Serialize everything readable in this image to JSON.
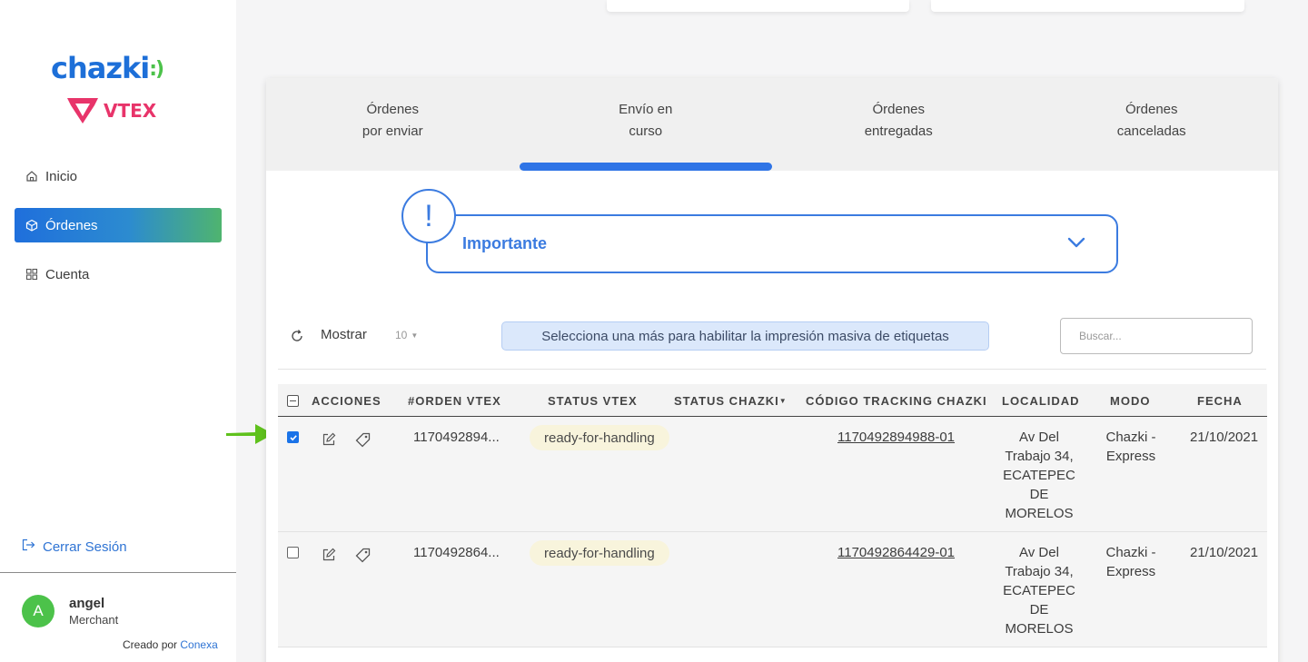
{
  "brand": {
    "chazki_text": "chazki",
    "chazki_signal": ":)",
    "vtex_text": "VTEX",
    "colors": {
      "primary": "#2f74e6",
      "green": "#4cc24a",
      "vtex": "#e8346a"
    }
  },
  "sidebar": {
    "items": [
      {
        "label": "Inicio",
        "icon": "home-icon",
        "active": false
      },
      {
        "label": "Órdenes",
        "icon": "box-icon",
        "active": true
      },
      {
        "label": "Cuenta",
        "icon": "grid-icon",
        "active": false
      }
    ],
    "logout_label": "Cerrar Sesión",
    "user": {
      "initial": "A",
      "name": "angel",
      "role": "Merchant"
    },
    "credit_prefix": "Creado por",
    "credit_link": "Conexa"
  },
  "tabs": [
    {
      "line1": "Órdenes",
      "line2": "por enviar",
      "active": false
    },
    {
      "line1": "Envío en",
      "line2": "curso",
      "active": true
    },
    {
      "line1": "Órdenes",
      "line2": "entregadas",
      "active": false
    },
    {
      "line1": "Órdenes",
      "line2": "canceladas",
      "active": false
    }
  ],
  "alert": {
    "icon_text": "!",
    "title": "Importante"
  },
  "toolbar": {
    "show_label": "Mostrar",
    "page_size": "10",
    "bulk_notice": "Selecciona una más para habilitar la impresión masiva de etiquetas",
    "search_placeholder": "Buscar..."
  },
  "table": {
    "headers": {
      "acciones": "ACCIONES",
      "orden": "#ORDEN VTEX",
      "status_vtex": "STATUS VTEX",
      "status_chazki": "STATUS CHAZKI",
      "tracking": "CÓDIGO TRACKING CHAZKI",
      "localidad": "LOCALIDAD",
      "modo": "MODO",
      "fecha": "FECHA"
    },
    "rows": [
      {
        "checked": true,
        "orden": "1170492894...",
        "status_vtex": "ready-for-handling",
        "tracking": "1170492894988-01",
        "localidad": [
          "Av Del",
          "Trabajo 34,",
          "ECATEPEC",
          "DE",
          "MORELOS"
        ],
        "modo": [
          "Chazki -",
          "Express"
        ],
        "fecha": "21/10/2021"
      },
      {
        "checked": false,
        "orden": "1170492864...",
        "status_vtex": "ready-for-handling",
        "tracking": "1170492864429-01",
        "localidad": [
          "Av Del",
          "Trabajo 34,",
          "ECATEPEC",
          "DE",
          "MORELOS"
        ],
        "modo": [
          "Chazki -",
          "Express"
        ],
        "fecha": "21/10/2021"
      }
    ]
  }
}
